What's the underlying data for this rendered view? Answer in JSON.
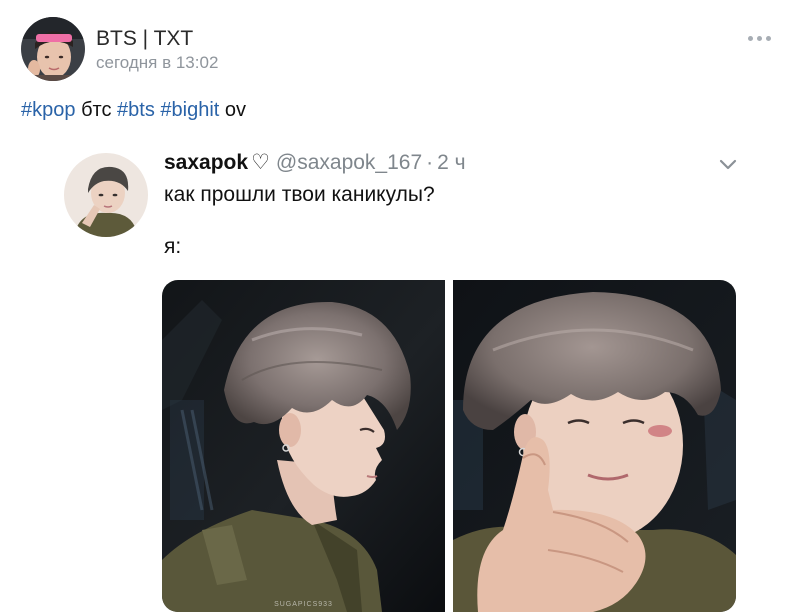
{
  "post": {
    "author": "BTS | TXT",
    "time": "сегодня в 13:02",
    "more_icon": "more-horizontal-icon",
    "text": {
      "tag_kpop": "#kpop",
      "word_bts_cyr": "бтс",
      "tag_bts": "#bts",
      "tag_bighit": "#bighit",
      "word_ov": "ov"
    }
  },
  "tweet": {
    "name": "saxapok",
    "heart": "♡",
    "handle": "@saxapok_167",
    "separator": "·",
    "time": "2 ч",
    "line1": "как прошли твои каникулы?",
    "line2": "я:",
    "chevron_icon": "chevron-down-icon",
    "watermark": "SUGAPICS933"
  },
  "colors": {
    "link": "#2a63a8",
    "muted": "#8f959c",
    "tweet_muted": "#7f868c",
    "background": "#ffffff"
  }
}
